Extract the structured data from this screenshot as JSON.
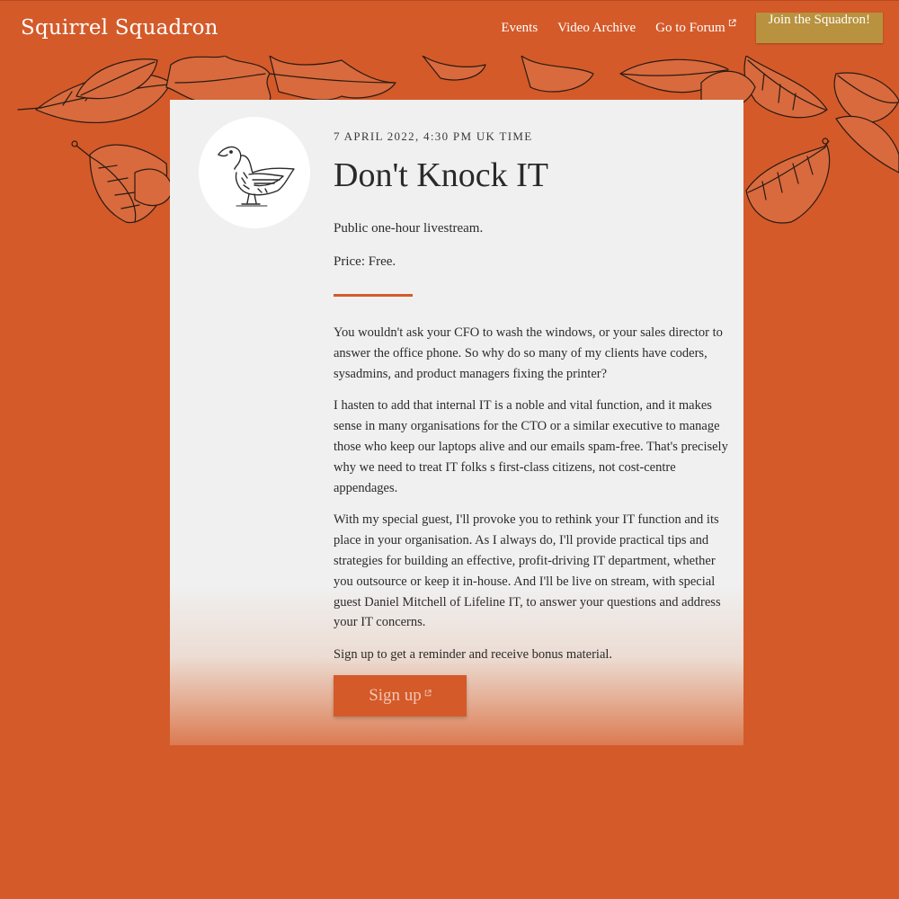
{
  "header": {
    "brand": "Squirrel Squadron",
    "nav": [
      {
        "label": "Events"
      },
      {
        "label": "Video Archive"
      },
      {
        "label": "Go to Forum",
        "icon": "external-link-icon"
      }
    ],
    "cta": "Join the Squadron!"
  },
  "event": {
    "date": "7 APRIL 2022, 4:30 PM UK TIME",
    "title": "Don't Knock IT",
    "format": "Public one-hour livestream.",
    "price": "Price: Free.",
    "paragraphs": [
      "You wouldn't ask your CFO to wash the windows, or your sales director to answer the office phone. So why do so many of my clients have coders, sysadmins, and product managers fixing the printer?",
      "I hasten to add that internal IT is a noble and vital function, and it makes sense in many organisations for the CTO or a similar executive to manage those who keep our laptops alive and our emails spam-free. That's precisely why we need to treat IT folks s first-class citizens, not cost-centre appendages.",
      "With my special guest, I'll provoke you to rethink your IT function and its place in your organisation. As I always do, I'll provide practical tips and strategies for building an effective, profit-driving IT department, whether you outsource or keep it in-house. And I'll be live on stream, with special guest Daniel Mitchell of Lifeline IT, to answer your questions and address your IT concerns.",
      "Sign up to get a reminder and receive bonus material."
    ],
    "signup": "Sign up",
    "avatar_icon": "duck-illustration"
  },
  "colors": {
    "background": "#d45a29",
    "card": "#f0f0f0",
    "cta": "#b8923e",
    "accent": "#d45a29"
  }
}
